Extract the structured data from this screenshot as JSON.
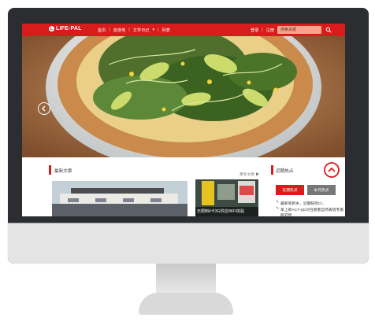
{
  "nav": {
    "logo_mark": "L",
    "logo": "LIFE-PAL",
    "links": [
      "首页",
      "旅游地",
      "文学日记",
      "列表"
    ],
    "right_links": [
      "登录",
      "注册"
    ],
    "search_placeholder": "搜索关键"
  },
  "hero": {
    "icons": {
      "prev": "chevron-left-icon"
    },
    "dots_count": 4
  },
  "content": {
    "latest_title": "最新文章",
    "more": "更多文章 ▶",
    "thumb2_caption": "无限制4卡3G供应WIFI体验",
    "hot_title": "近期热点",
    "tabs": [
      "近期热点",
      "本月热点"
    ],
    "news": [
      "最新早新乡，近期研究Cl...",
      "早上新ACT-QE对在跑者自然表现专家研究所"
    ]
  },
  "colors": {
    "brand_red": "#d81c1c",
    "screen_frame": "#2b2d30",
    "chin": "#e4e4e4"
  }
}
